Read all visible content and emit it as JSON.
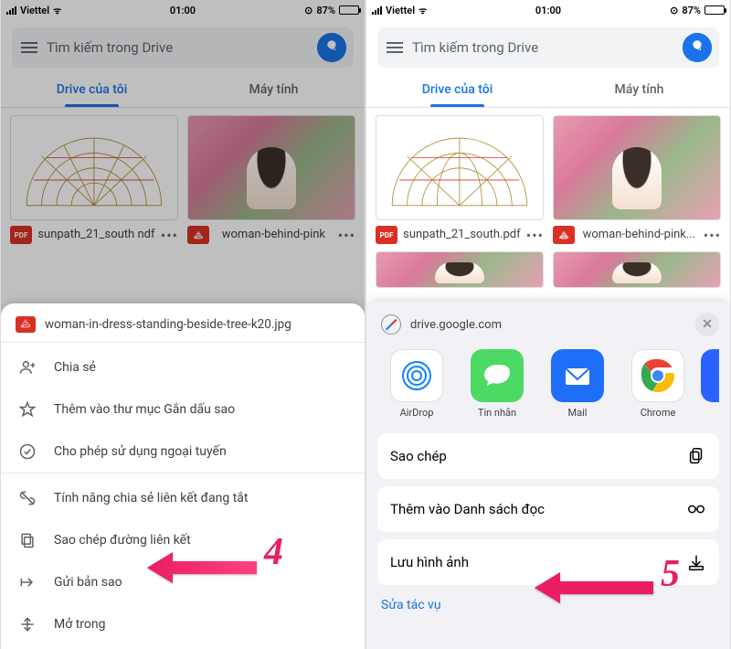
{
  "status": {
    "carrier": "Viettel",
    "wifi_icon": "wifi",
    "time": "01:00",
    "alarm": "⊙",
    "battery_pct": "87%"
  },
  "search": {
    "placeholder": "Tìm kiếm trong Drive"
  },
  "tabs": {
    "my_drive": "Drive của tôi",
    "computers": "Máy tính"
  },
  "files": {
    "left_name": "sunpath_21_south.pdf",
    "left_name_trunc": "sunpath_21_south ndf",
    "right_name": "woman-behind-pink",
    "right_name_full": "woman-behind-pink...",
    "pdf_badge": "PDF",
    "img_badge": "▲"
  },
  "sheet": {
    "title": "woman-in-dress-standing-beside-tree-k20.jpg",
    "share": "Chia sẻ",
    "star": "Thêm vào thư mục Gắn dấu sao",
    "offline": "Cho phép sử dụng ngoại tuyến",
    "link_off": "Tính năng chia sẻ liên kết đang tắt",
    "copy_link": "Sao chép đường liên kết",
    "send_copy": "Gửi bản sao",
    "open_in": "Mở trong"
  },
  "share": {
    "domain": "drive.google.com",
    "airdrop": "AirDrop",
    "messages": "Tin nhắn",
    "mail": "Mail",
    "chrome": "Chrome",
    "copy": "Sao chép",
    "reading_list": "Thêm vào Danh sách đọc",
    "save_image": "Lưu hình ảnh",
    "edit_actions": "Sửa tác vụ"
  },
  "annotations": {
    "step4": "4",
    "step5": "5"
  }
}
